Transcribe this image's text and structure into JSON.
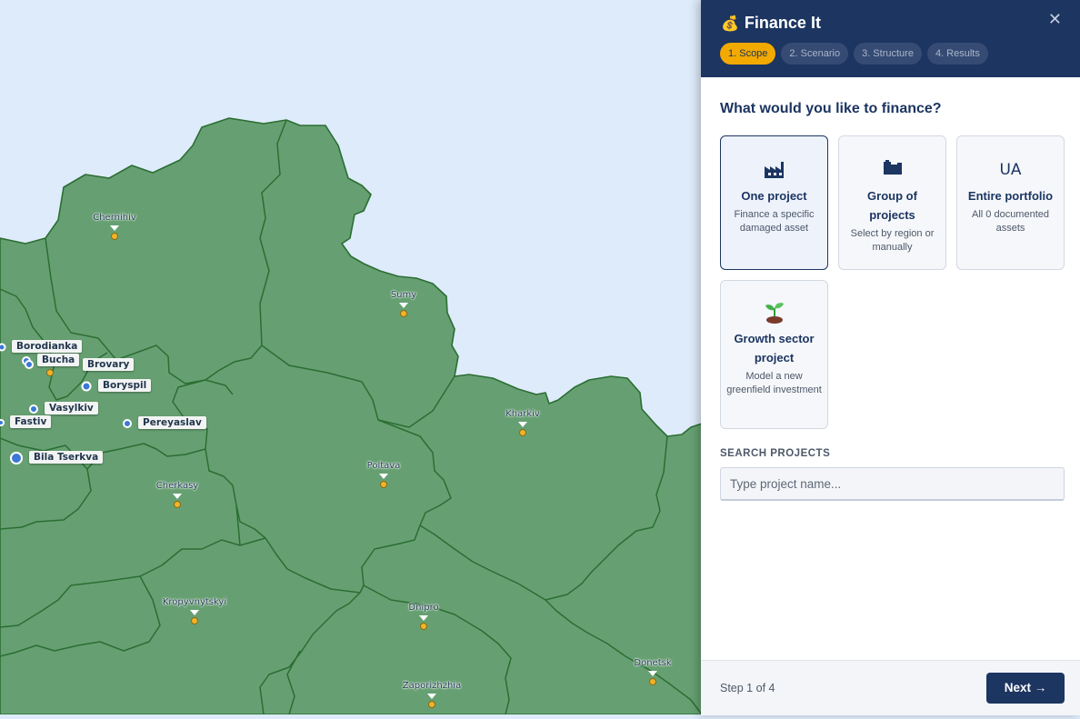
{
  "map": {
    "oblasts": [
      {
        "name": "Chernihiv"
      },
      {
        "name": "Sumy"
      },
      {
        "name": "Kharkiv"
      },
      {
        "name": "Poltava"
      },
      {
        "name": "Cherkasy"
      },
      {
        "name": "Kropyvnytskyi"
      },
      {
        "name": "Dnipro"
      },
      {
        "name": "Donetsk"
      },
      {
        "name": "Zaporizhzhia"
      }
    ],
    "assets": [
      {
        "name": "Borodianka"
      },
      {
        "name": "Bucha"
      },
      {
        "name": "Brovary"
      },
      {
        "name": "Boryspil"
      },
      {
        "name": "Vasylkiv"
      },
      {
        "name": "Fastiv"
      },
      {
        "name": "Pereyaslav"
      },
      {
        "name": "Bila Tserkva"
      }
    ],
    "colors": {
      "water": "#deebfa",
      "land": "#66a072",
      "borders": "#2b6e33"
    }
  },
  "panel": {
    "title": "Finance It",
    "title_icon": "money-bag-icon",
    "steps": [
      "1. Scope",
      "2. Scenario",
      "3. Structure",
      "4. Results"
    ],
    "active_step": 1,
    "question": "What would you like to finance?",
    "options": [
      {
        "icon": "factory-icon",
        "title": "One project",
        "desc": "Finance a specific damaged asset",
        "selected": true
      },
      {
        "icon": "buildings-icon",
        "title": "Group of projects",
        "desc": "Select by region or manually",
        "selected": false
      },
      {
        "icon_text": "UA",
        "title": "Entire portfolio",
        "desc": "All 0 documented assets",
        "selected": false
      },
      {
        "icon": "seedling-icon",
        "title": "Growth sector project",
        "desc": "Model a new greenfield investment",
        "selected": false
      }
    ],
    "search": {
      "label": "SEARCH PROJECTS",
      "placeholder": "Type project name..."
    },
    "footer": {
      "step_text": "Step 1 of 4",
      "next_label": "Next →"
    },
    "colors": {
      "header": "#1c3561",
      "accent": "#f2a900"
    }
  }
}
